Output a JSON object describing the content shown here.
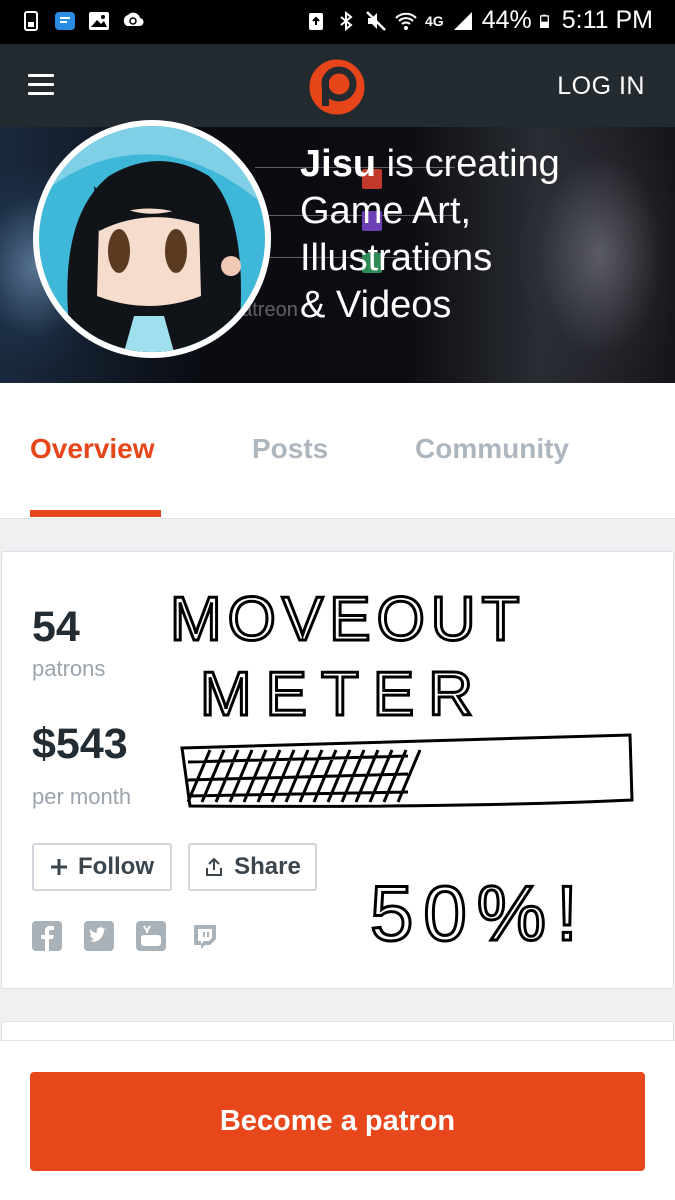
{
  "status_bar": {
    "network": "4G",
    "battery": "44%",
    "time": "5:11 PM",
    "icons": [
      "sim-icon",
      "messages-icon",
      "gallery-icon",
      "sync-icon",
      "recycle-icon",
      "bluetooth-icon",
      "mute-icon",
      "wifi-icon",
      "signal-icon",
      "battery-icon"
    ]
  },
  "app_bar": {
    "menu_icon": "hamburger-icon",
    "logo": "patreon-logo",
    "login_label": "LOG IN"
  },
  "banner": {
    "creator_name": "Jisu",
    "headline_rest_1": " is creating",
    "headline_line2": "Game Art,",
    "headline_line3": "Illustrations",
    "headline_line4": "& Videos",
    "watermark": "patreon"
  },
  "tabs": [
    {
      "label": "Overview",
      "active": true
    },
    {
      "label": "Posts",
      "active": false
    },
    {
      "label": "Community",
      "active": false
    }
  ],
  "stats": {
    "patrons_count": "54",
    "patrons_label": "patrons",
    "amount": "$543",
    "amount_label": "per month"
  },
  "actions": {
    "follow_label": "Follow",
    "share_label": "Share"
  },
  "social_icons": [
    "facebook-icon",
    "twitter-icon",
    "youtube-icon",
    "twitch-icon"
  ],
  "handwritten": {
    "line1": "MOVEOUT",
    "line2": "METER",
    "percent": "50%!",
    "meter_progress": 0.5
  },
  "cta": {
    "label": "Become a patron"
  },
  "colors": {
    "accent": "#e6461a",
    "cta": "#e8471b",
    "appbar": "#232a30",
    "tab_inactive": "#adb6bf",
    "text_dark": "#242c33",
    "text_muted": "#9ba4ad"
  }
}
